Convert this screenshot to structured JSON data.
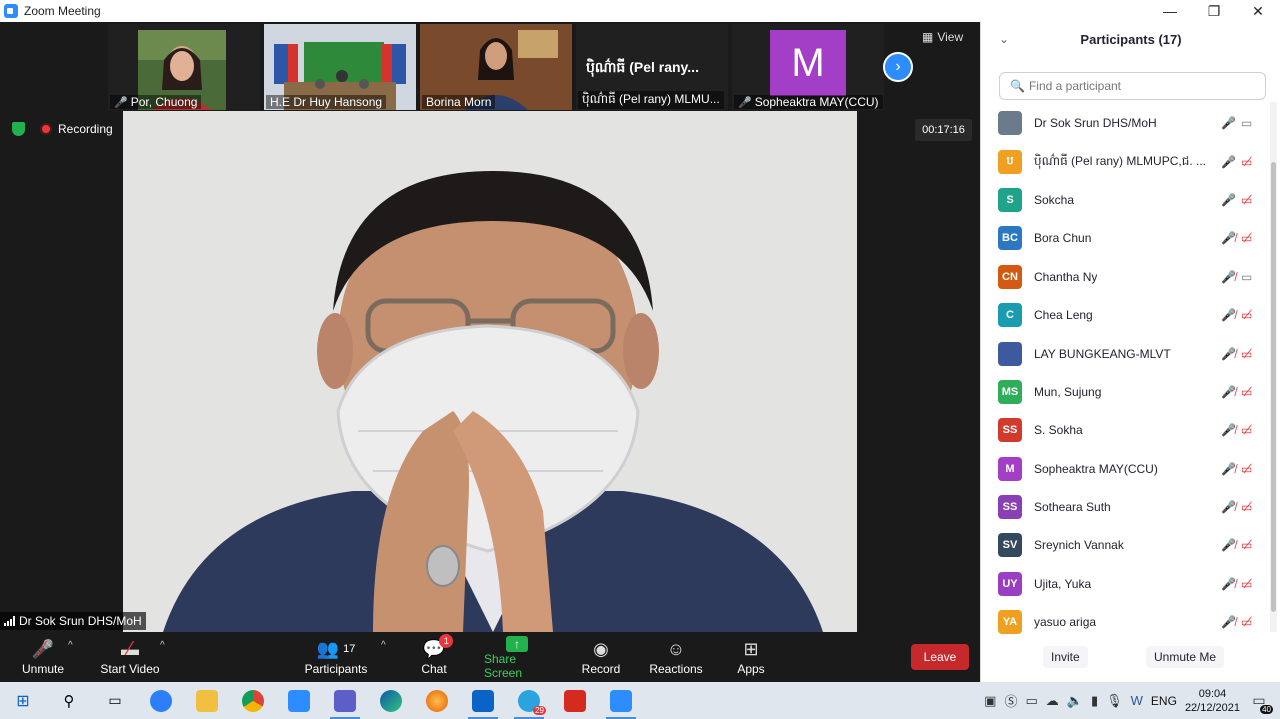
{
  "window": {
    "title": "Zoom Meeting",
    "controls": [
      "—",
      "❐",
      "✕"
    ]
  },
  "gallery": {
    "thumbnails": [
      {
        "name": "Por, Chuong",
        "muted": true,
        "type": "video"
      },
      {
        "name": "H.E Dr Huy Hansong",
        "muted": false,
        "type": "video"
      },
      {
        "name": "Borina Morn",
        "muted": false,
        "type": "video"
      },
      {
        "name": "ប៉ិណ៌ាធី (Pel rany) MLMU...",
        "display_text": "ប៉ិណ៌ាធី (Pel rany...",
        "muted": false,
        "type": "name"
      },
      {
        "name": "Sopheaktra MAY(CCU)",
        "muted": true,
        "type": "avatar",
        "letter": "M"
      }
    ],
    "view_label": "View"
  },
  "meeting": {
    "recording_label": "Recording",
    "timer": "00:17:16",
    "active_speaker": "Dr Sok Srun DHS/MoH"
  },
  "toolbar": {
    "unmute": "Unmute",
    "start_video": "Start Video",
    "participants": "Participants",
    "participant_count": "17",
    "chat": "Chat",
    "chat_badge": "1",
    "share_screen": "Share Screen",
    "record": "Record",
    "reactions": "Reactions",
    "apps": "Apps",
    "leave": "Leave"
  },
  "panel": {
    "title": "Participants (17)",
    "search_placeholder": "Find a participant",
    "invite": "Invite",
    "unmute_me": "Unmute Me",
    "participants": [
      {
        "name": "Dr Sok Srun DHS/MoH",
        "initials": "",
        "color": "#6b7b8c",
        "mic_muted": false,
        "cam_off": false
      },
      {
        "name": "ប៉ិណ៌ាធី (Pel rany) MLMUPC,ជ. ...",
        "initials": "ប",
        "color": "#f0a020",
        "mic_muted": false,
        "cam_off": true
      },
      {
        "name": "Sokcha",
        "initials": "S",
        "color": "#1fa38a",
        "mic_muted": false,
        "cam_off": true
      },
      {
        "name": "Bora Chun",
        "initials": "BC",
        "color": "#2b77c2",
        "mic_muted": true,
        "cam_off": true
      },
      {
        "name": "Chantha Ny",
        "initials": "CN",
        "color": "#d35a10",
        "mic_muted": true,
        "cam_off": false
      },
      {
        "name": "Chea Leng",
        "initials": "C",
        "color": "#1a9bb0",
        "mic_muted": true,
        "cam_off": true
      },
      {
        "name": "LAY BUNGKEANG-MLVT",
        "initials": "",
        "color": "#3d5a9e",
        "mic_muted": true,
        "cam_off": true
      },
      {
        "name": "Mun, Sujung",
        "initials": "MS",
        "color": "#2fae5a",
        "mic_muted": true,
        "cam_off": true
      },
      {
        "name": "S. Sokha",
        "initials": "SS",
        "color": "#d13b2c",
        "mic_muted": true,
        "cam_off": true
      },
      {
        "name": "Sopheaktra MAY(CCU)",
        "initials": "M",
        "color": "#a33ec6",
        "mic_muted": true,
        "cam_off": true
      },
      {
        "name": "Sotheara Suth",
        "initials": "SS",
        "color": "#8a3fb5",
        "mic_muted": true,
        "cam_off": true
      },
      {
        "name": "Sreynich Vannak",
        "initials": "SV",
        "color": "#35495e",
        "mic_muted": true,
        "cam_off": true
      },
      {
        "name": "Ujita, Yuka",
        "initials": "UY",
        "color": "#9b3fc2",
        "mic_muted": true,
        "cam_off": true
      },
      {
        "name": "yasuo ariga",
        "initials": "YA",
        "color": "#f0a020",
        "mic_muted": true,
        "cam_off": true
      }
    ]
  },
  "taskbar": {
    "language": "ENG",
    "time": "09:04",
    "date": "22/12/2021",
    "notification_count": "40",
    "outlook_badge": "",
    "telegram_badge": "29"
  }
}
